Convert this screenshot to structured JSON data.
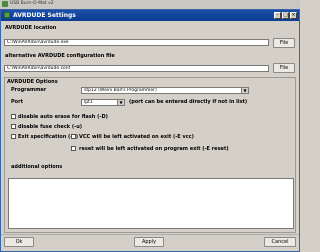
{
  "window": {
    "title": "USB Burn-O-Mat v2"
  },
  "dialog": {
    "title": "AVRDUDE Settings"
  },
  "avrdude_location": {
    "label": "AVRDUDE location",
    "value": "C:\\WinAVR\\bin\\avrdude.exe",
    "file_button": "File"
  },
  "alt_config": {
    "label": "alternative AVRDUDE configuration file",
    "value": "C:\\WinAVR\\bin\\avrdude.conf",
    "file_button": "File"
  },
  "options": {
    "label": "AVRDUDE Options",
    "programmer_label": "Programmer",
    "programmer_value": "stp12 (Weini Ball's Programmer)",
    "port_label": "Port",
    "port_value": "lpt1",
    "port_note": "(port can be entered directly if not in list)",
    "checkboxes": {
      "disable_auto_erase": "disable auto erase for flash (-D)",
      "disable_fuse_check": "disable fuse check (-u)",
      "exit_spec": "Exit specification (-E)",
      "vcc_left": "VCC will be left activated on exit (-E vcc)",
      "reset_left": "reset will be left activated on program exit (-E reset)"
    },
    "additional_label": "additional options",
    "additional_value": ""
  },
  "buttons": {
    "ok": "Ok",
    "apply": "Apply",
    "cancel": "Cancel"
  }
}
